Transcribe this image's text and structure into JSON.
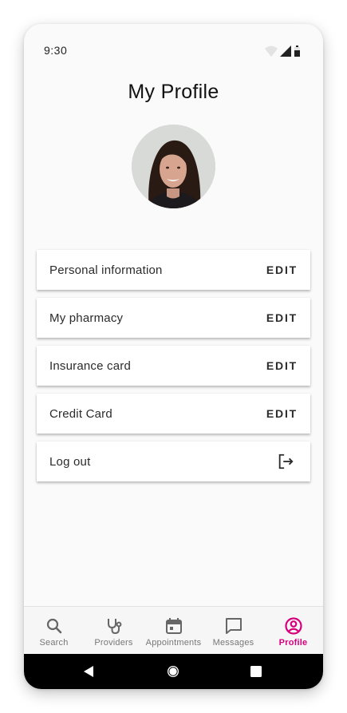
{
  "status_bar": {
    "time": "9:30",
    "icons": [
      "wifi-icon",
      "signal-icon",
      "battery-icon"
    ]
  },
  "header": {
    "title": "My Profile"
  },
  "profile": {
    "avatar": "avatar-photo"
  },
  "cards": [
    {
      "label": "Personal information",
      "action": "EDIT"
    },
    {
      "label": "My pharmacy",
      "action": "EDIT"
    },
    {
      "label": "Insurance card",
      "action": "EDIT"
    },
    {
      "label": "Credit Card",
      "action": "EDIT"
    },
    {
      "label": "Log out",
      "icon": "logout-icon"
    }
  ],
  "bottom_nav": {
    "items": [
      {
        "label": "Search",
        "icon": "search-icon"
      },
      {
        "label": "Providers",
        "icon": "stethoscope-icon"
      },
      {
        "label": "Appointments",
        "icon": "calendar-icon"
      },
      {
        "label": "Messages",
        "icon": "message-icon"
      },
      {
        "label": "Profile",
        "icon": "account-circle-icon",
        "active": true
      }
    ]
  },
  "system_nav": {
    "icons": [
      "back-icon",
      "home-icon",
      "recents-icon"
    ]
  },
  "colors": {
    "accent": "#d6007d",
    "background": "#fafafa",
    "card": "#ffffff",
    "nav_inactive": "#777777"
  }
}
